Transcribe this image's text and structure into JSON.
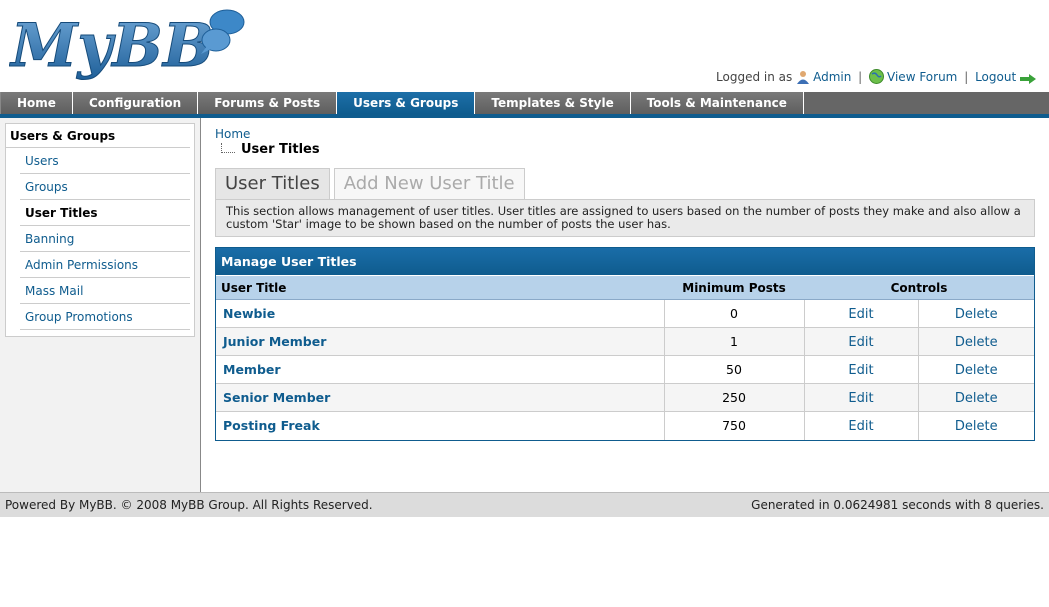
{
  "header": {
    "logo_text": "MyBB",
    "logged_in_as": "Logged in as",
    "user": "Admin",
    "view_forum": "View Forum",
    "logout": "Logout",
    "separator": "|"
  },
  "menu": [
    {
      "label": "Home"
    },
    {
      "label": "Configuration"
    },
    {
      "label": "Forums & Posts"
    },
    {
      "label": "Users & Groups"
    },
    {
      "label": "Templates & Style"
    },
    {
      "label": "Tools & Maintenance"
    }
  ],
  "sidebar": {
    "title": "Users & Groups",
    "items": [
      {
        "label": "Users"
      },
      {
        "label": "Groups"
      },
      {
        "label": "User Titles"
      },
      {
        "label": "Banning"
      },
      {
        "label": "Admin Permissions"
      },
      {
        "label": "Mass Mail"
      },
      {
        "label": "Group Promotions"
      }
    ]
  },
  "breadcrumb": {
    "home": "Home",
    "current": "User Titles"
  },
  "tabs": [
    {
      "label": "User Titles"
    },
    {
      "label": "Add New User Title"
    }
  ],
  "description": "This section allows management of user titles. User titles are assigned to users based on the number of posts they make and also allow a custom 'Star' image to be shown based on the number of posts the user has.",
  "table": {
    "title": "Manage User Titles",
    "columns": {
      "title": "User Title",
      "min_posts": "Minimum Posts",
      "controls": "Controls"
    },
    "rows": [
      {
        "title": "Newbie",
        "min_posts": "0",
        "edit": "Edit",
        "delete": "Delete"
      },
      {
        "title": "Junior Member",
        "min_posts": "1",
        "edit": "Edit",
        "delete": "Delete"
      },
      {
        "title": "Member",
        "min_posts": "50",
        "edit": "Edit",
        "delete": "Delete"
      },
      {
        "title": "Senior Member",
        "min_posts": "250",
        "edit": "Edit",
        "delete": "Delete"
      },
      {
        "title": "Posting Freak",
        "min_posts": "750",
        "edit": "Edit",
        "delete": "Delete"
      }
    ]
  },
  "footer": {
    "left": "Powered By MyBB. © 2008 MyBB Group. All Rights Reserved.",
    "right": "Generated in 0.0624981 seconds with 8 queries."
  },
  "colors": {
    "brand_blue": "#0f5c8e",
    "menu_gray": "#666666",
    "header_row": "#b7d2ea"
  }
}
